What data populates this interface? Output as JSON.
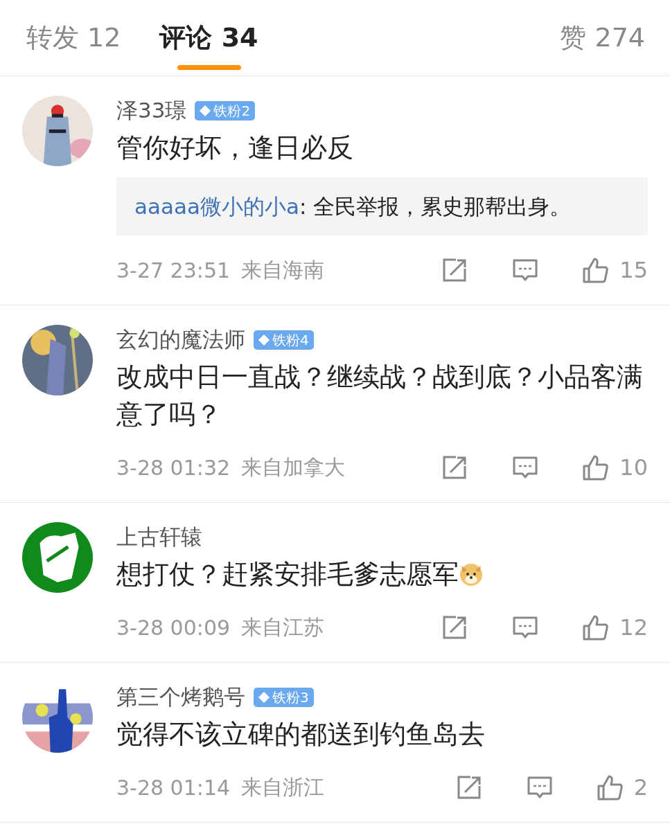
{
  "tabs": [
    {
      "label": "转发 12",
      "selected": false
    },
    {
      "label": "评论 34",
      "selected": true
    }
  ],
  "likes_tab": "赞 274",
  "comments": [
    {
      "name": "泽33璟",
      "badge": "铁粉2",
      "text": "管你好坏，逢日必反",
      "emoji": false,
      "replies": [
        {
          "author": "aaaaa微小的小a",
          "text": ": 全民举报，累史那帮出身。"
        }
      ],
      "time": "3-27 23:51",
      "source": "来自海南",
      "likes": "15"
    },
    {
      "name": "玄幻的魔法师",
      "badge": "铁粉4",
      "text": "改成中日一直战？继续战？战到底？小品客满意了吗？",
      "emoji": false,
      "time": "3-28 01:32",
      "source": "来自加拿大",
      "likes": "10"
    },
    {
      "name": "上古轩辕",
      "text": "想打仗？赶紧安排毛爹志愿军",
      "emoji": true,
      "time": "3-28 00:09",
      "source": "来自江苏",
      "likes": "12"
    },
    {
      "name": "第三个烤鹅号",
      "badge": "铁粉3",
      "text": "觉得不该立碑的都送到钓鱼岛去",
      "emoji": false,
      "time": "3-28 01:14",
      "source": "来自浙江",
      "likes": "2"
    }
  ]
}
